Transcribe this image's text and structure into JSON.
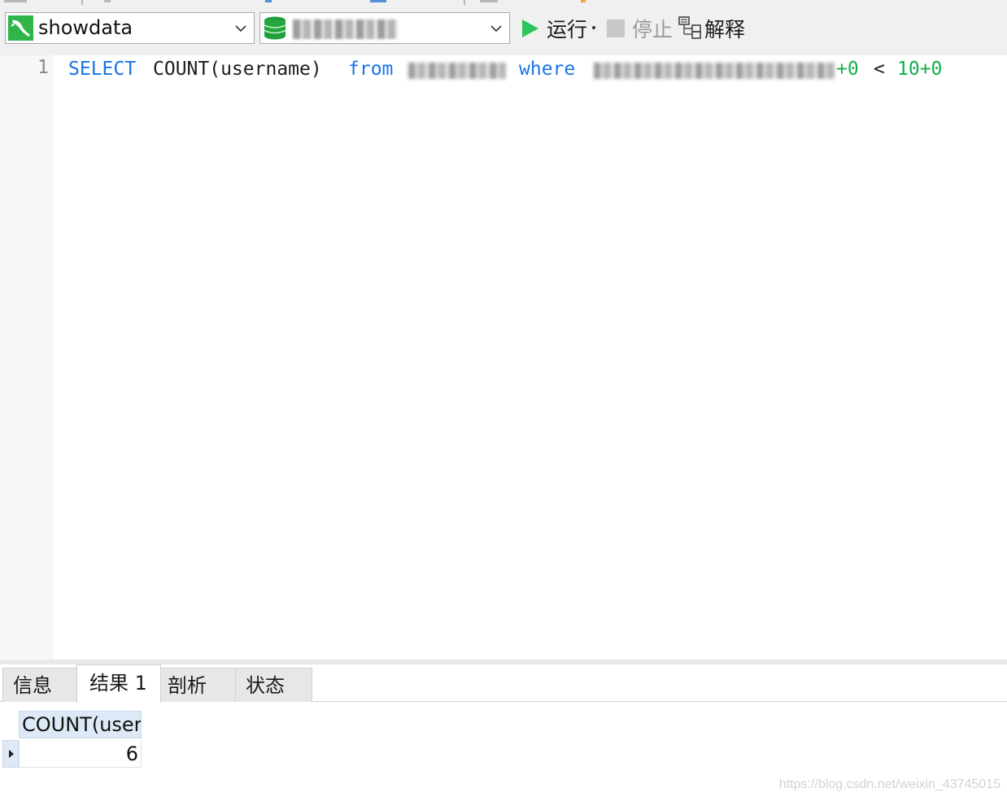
{
  "toolbar": {
    "connection": {
      "selected": "showdata"
    },
    "database": {
      "selected": ""
    },
    "run_label": "运行",
    "stop_label": "停止",
    "explain_label": "解释"
  },
  "editor": {
    "line_number": "1",
    "tokens": {
      "select": "SELECT",
      "count_fn": "COUNT(username)",
      "from": "from",
      "where": "where",
      "plus_zero": "+0",
      "less_than": "<",
      "rhs": "10+0"
    }
  },
  "result_tabs": [
    {
      "label": "信息"
    },
    {
      "label": "结果 1",
      "active": true
    },
    {
      "label": "剖析"
    },
    {
      "label": "状态"
    }
  ],
  "result_grid": {
    "columns": [
      "COUNT(user"
    ],
    "rows": [
      [
        "6"
      ]
    ]
  },
  "watermark": "https://blog.csdn.net/weixin_43745015",
  "colors": {
    "keyword": "#1874e8",
    "number": "#10b04a",
    "run_icon": "#2fc45a",
    "header_bg": "#dde9f6"
  }
}
